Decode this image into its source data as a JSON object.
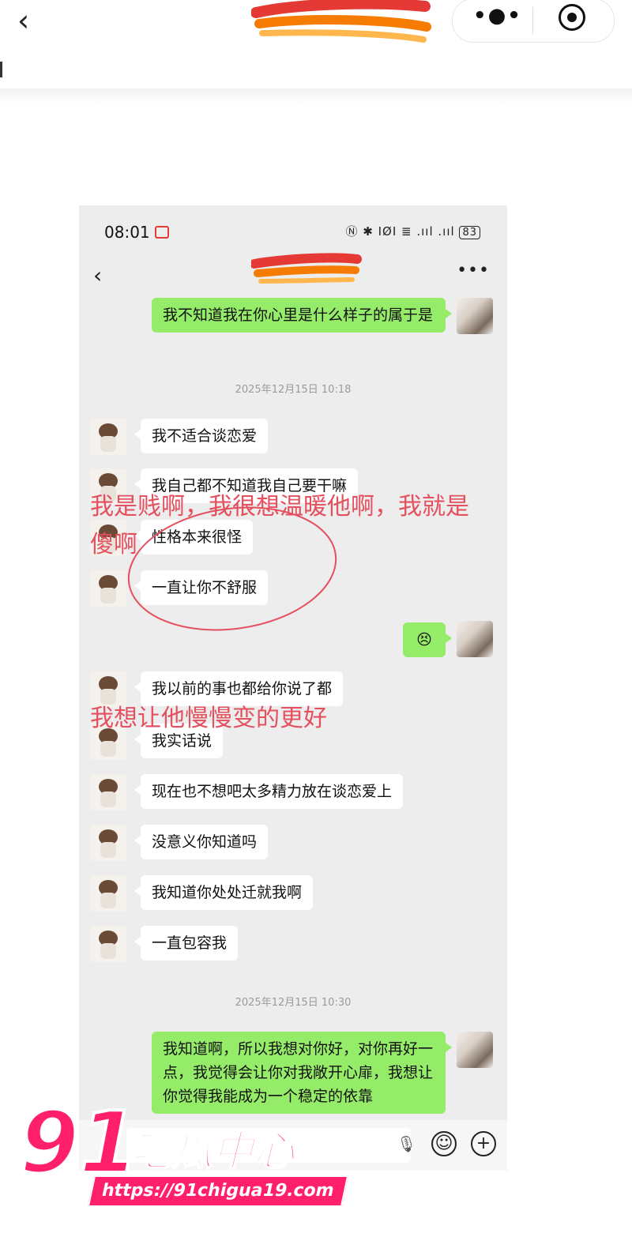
{
  "topbar": {
    "back_icon": "chevron-left-icon",
    "more_icon": "more-dots-icon",
    "target_icon": "target-icon"
  },
  "screenshot": {
    "status": {
      "time": "08:01",
      "icons": "Ⓝ ✱ ΙØΙ ≣ .ııl .ııl",
      "battery": "83"
    },
    "messages": [
      {
        "from": "me",
        "text": "我不知道我在你心里是什么样子的属于是"
      },
      {
        "from": "time",
        "text": "2025年12月15日 10:18"
      },
      {
        "from": "other",
        "text": "我不适合谈恋爱"
      },
      {
        "from": "other",
        "text": "我自己都不知道我自己要干嘛"
      },
      {
        "from": "other",
        "text": "性格本来很怪"
      },
      {
        "from": "other",
        "text": "一直让你不舒服"
      },
      {
        "from": "me",
        "text": "😣"
      },
      {
        "from": "other",
        "text": "我以前的事也都给你说了都"
      },
      {
        "from": "other",
        "text": "我实话说"
      },
      {
        "from": "other",
        "text": "现在也不想吧太多精力放在谈恋爱上"
      },
      {
        "from": "other",
        "text": "没意义你知道吗"
      },
      {
        "from": "other",
        "text": "我知道你处处迁就我啊"
      },
      {
        "from": "other",
        "text": "一直包容我"
      },
      {
        "from": "time",
        "text": "2025年12月15日 10:30"
      },
      {
        "from": "me",
        "text": "我知道啊，所以我想对你好，对你再好一点，我觉得会让你对我敞开心扉，我想让你觉得我能成为一个稳定的依靠"
      }
    ],
    "annotations": {
      "line1": "我是贱啊，我很想温暖他啊，我就是",
      "line2": "傻啊",
      "line3": "我想让他慢慢变的更好"
    }
  },
  "watermark": {
    "number": "91",
    "name": "吃瓜中心",
    "url": "https://91chigua19.com"
  }
}
